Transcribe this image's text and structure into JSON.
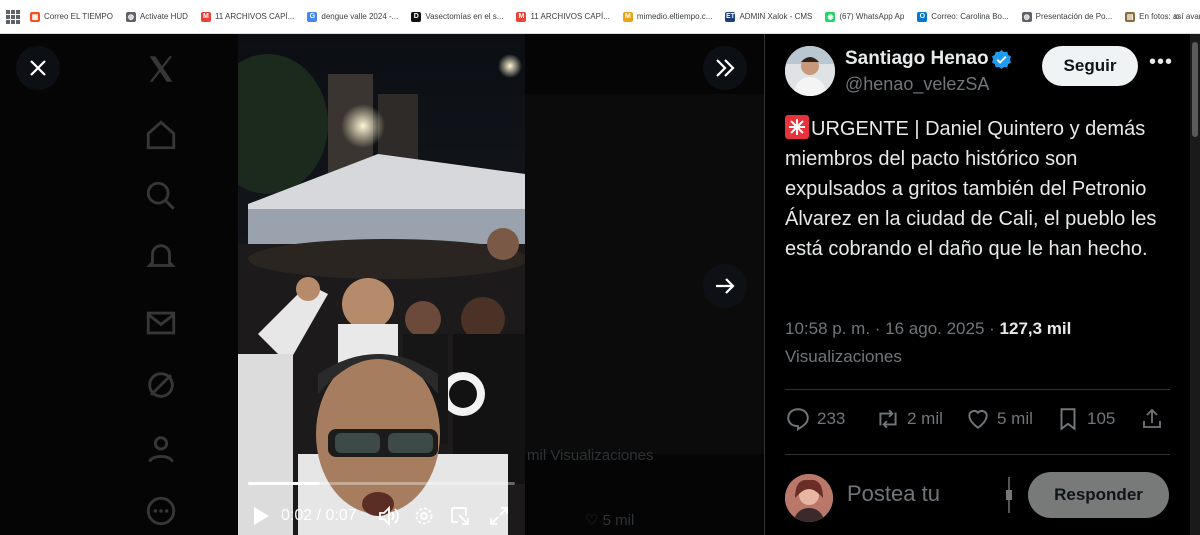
{
  "bookmarks": [
    {
      "label": "Correo EL TIEMPO",
      "icon": "microsoft-icon",
      "color": "#f25022"
    },
    {
      "label": "Activate HUD",
      "icon": "globe-icon",
      "color": "#5f6368"
    },
    {
      "label": "11 ARCHIVOS CAPÍ...",
      "icon": "gmail-icon",
      "color": "#ea4335"
    },
    {
      "label": "dengue valle 2024 -...",
      "icon": "google-icon",
      "color": "#4285f4"
    },
    {
      "label": "Vasectomías en el s...",
      "icon": "d-icon",
      "color": "#111111"
    },
    {
      "label": "11 ARCHIVOS CAPÍ...",
      "icon": "gmail-icon",
      "color": "#ea4335"
    },
    {
      "label": "mimedio.eltiempo.c...",
      "icon": "m-icon",
      "color": "#e8a317"
    },
    {
      "label": "ADMIN Xalok - CMS",
      "icon": "et-icon",
      "color": "#1a3d7c"
    },
    {
      "label": "(67) WhatsApp Ap",
      "icon": "whatsapp-icon",
      "color": "#25d366"
    },
    {
      "label": "Correo: Carolina Bo...",
      "icon": "outlook-icon",
      "color": "#0078d4"
    },
    {
      "label": "Presentación de Po...",
      "icon": "globe-icon",
      "color": "#5f6368"
    },
    {
      "label": "En fotos: así avanza...",
      "icon": "newspaper-icon",
      "color": "#8a6d3b"
    }
  ],
  "video": {
    "current_time": "0:02",
    "duration": "0:07",
    "progress_fraction": 0.27
  },
  "background": {
    "views_label": "mil Visualizaciones",
    "likes_label": "5 mil"
  },
  "profile": {
    "name": "Santiago Henao",
    "handle": "@henao_velezSA",
    "follow_label": "Seguir",
    "more_label": "•••"
  },
  "tweet": {
    "text": "URGENTE | Daniel Quintero y demás miembros del pacto histórico son expulsados a gritos también del Petronio Álvarez en la ciudad de Cali, el pueblo les está cobrando el daño que le han hecho.",
    "timestamp": "10:58 p. m. · 16 ago. 2025 · ",
    "views_count": "127,3 mil",
    "views_label": "Visualizaciones"
  },
  "actions": {
    "replies": "233",
    "reposts": "2 mil",
    "likes": "5 mil",
    "bookmarks": "105"
  },
  "reply": {
    "placeholder": "Postea tu",
    "button_label": "Responder"
  },
  "colors": {
    "verified_blue": "#1d9bf0",
    "text_primary": "#e7e9ea",
    "text_secondary": "#71767b",
    "border": "#2f3336"
  }
}
